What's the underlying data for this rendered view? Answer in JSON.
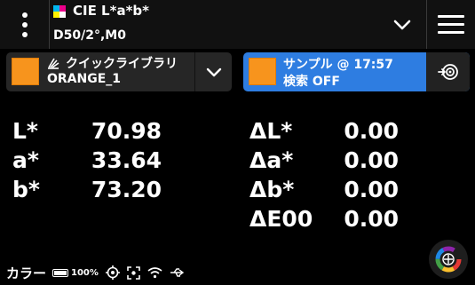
{
  "header": {
    "title": "CIE L*a*b*",
    "subtitle": "D50/2°,M0",
    "icons": [
      "kebab-menu-icon",
      "cmyk-icon",
      "chevron-down-icon",
      "hamburger-menu-icon"
    ]
  },
  "library": {
    "label": "クイックライブラリ",
    "color_name": "ORANGE_1",
    "swatch_color": "#f7941d"
  },
  "sample": {
    "label": "サンプル @ 17:57",
    "search": "検索 OFF",
    "swatch_color": "#f7941d",
    "accent": "#2e7de1"
  },
  "values": {
    "L": {
      "label": "L*",
      "value": "70.98"
    },
    "a": {
      "label": "a*",
      "value": "33.64"
    },
    "b": {
      "label": "b*",
      "value": "73.20"
    }
  },
  "deltas": {
    "dL": {
      "label": "ΔL*",
      "value": "0.00"
    },
    "da": {
      "label": "Δa*",
      "value": "0.00"
    },
    "db": {
      "label": "Δb*",
      "value": "0.00"
    },
    "dE": {
      "label": "ΔE00",
      "value": "0.00"
    }
  },
  "status": {
    "mode": "カラー",
    "battery": "100%",
    "icons": [
      "battery-icon",
      "target-icon",
      "scan-icon",
      "wifi-icon",
      "usb-icon",
      "color-wheel-icon"
    ]
  }
}
